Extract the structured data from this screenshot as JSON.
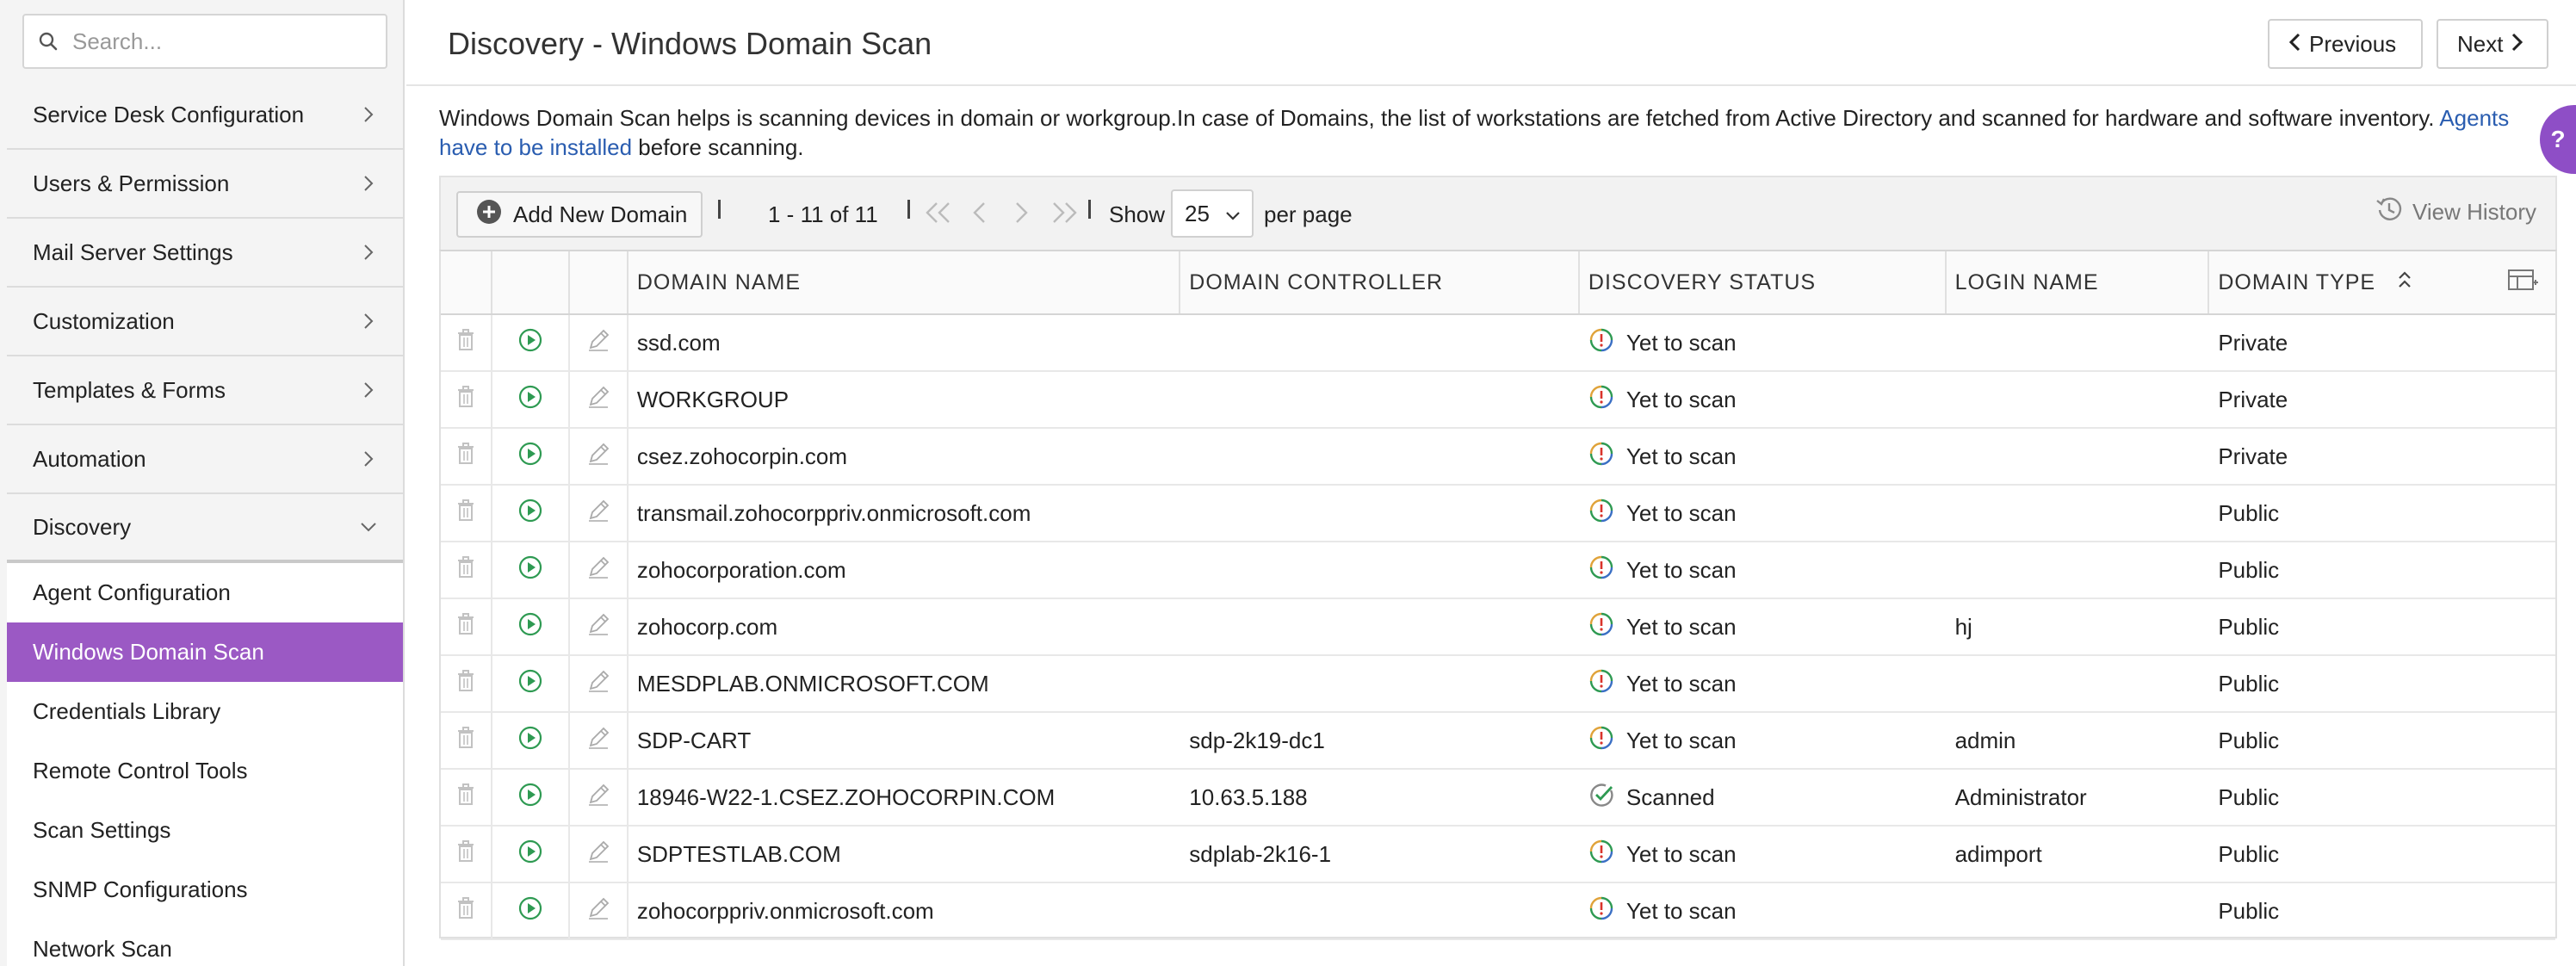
{
  "search": {
    "placeholder": "Search..."
  },
  "sidebar": {
    "items": [
      {
        "label": "Service Desk Configuration"
      },
      {
        "label": "Users & Permission"
      },
      {
        "label": "Mail Server Settings"
      },
      {
        "label": "Customization"
      },
      {
        "label": "Templates & Forms"
      },
      {
        "label": "Automation"
      },
      {
        "label": "Discovery"
      }
    ],
    "sub_items": [
      {
        "label": "Agent Configuration"
      },
      {
        "label": "Windows Domain Scan"
      },
      {
        "label": "Credentials Library"
      },
      {
        "label": "Remote Control Tools"
      },
      {
        "label": "Scan Settings"
      },
      {
        "label": "SNMP Configurations"
      },
      {
        "label": "Network Scan"
      }
    ],
    "active_sub": "Windows Domain Scan"
  },
  "header": {
    "title": "Discovery - Windows Domain Scan",
    "previous_label": "Previous",
    "next_label": "Next"
  },
  "description": {
    "text": "Windows Domain Scan helps is scanning devices in domain or workgroup.In case of Domains, the list of workstations are fetched from Active Directory and scanned for hardware and software inventory. ",
    "link_text": "Agents have to be installed",
    "suffix": " before scanning."
  },
  "help": {
    "label": "?"
  },
  "toolbar": {
    "add_label": "Add New Domain",
    "page_range": "1 - 11 of 11",
    "show_label": "Show",
    "per_page_value": "25",
    "per_page_label": "per page",
    "view_history_label": "View History"
  },
  "table": {
    "columns": [
      "DOMAIN NAME",
      "DOMAIN CONTROLLER",
      "DISCOVERY STATUS",
      "LOGIN NAME",
      "DOMAIN TYPE"
    ],
    "rows": [
      {
        "name": "ssd.com",
        "controller": "",
        "status": "Yet to scan",
        "login": "",
        "type": "Private"
      },
      {
        "name": "WORKGROUP",
        "controller": "",
        "status": "Yet to scan",
        "login": "",
        "type": "Private"
      },
      {
        "name": "csez.zohocorpin.com",
        "controller": "",
        "status": "Yet to scan",
        "login": "",
        "type": "Private"
      },
      {
        "name": "transmail.zohocorppriv.onmicrosoft.com",
        "controller": "",
        "status": "Yet to scan",
        "login": "",
        "type": "Public"
      },
      {
        "name": "zohocorporation.com",
        "controller": "",
        "status": "Yet to scan",
        "login": "",
        "type": "Public"
      },
      {
        "name": "zohocorp.com",
        "controller": "",
        "status": "Yet to scan",
        "login": "hj",
        "type": "Public"
      },
      {
        "name": "MESDPLAB.ONMICROSOFT.COM",
        "controller": "",
        "status": "Yet to scan",
        "login": "",
        "type": "Public"
      },
      {
        "name": "SDP-CART",
        "controller": "sdp-2k19-dc1",
        "status": "Yet to scan",
        "login": "admin",
        "type": "Public"
      },
      {
        "name": "18946-W22-1.CSEZ.ZOHOCORPIN.COM",
        "controller": "10.63.5.188",
        "status": "Scanned",
        "login": "Administrator",
        "type": "Public"
      },
      {
        "name": "SDPTESTLAB.COM",
        "controller": "sdplab-2k16-1",
        "status": "Yet to scan",
        "login": "adimport",
        "type": "Public"
      },
      {
        "name": "zohocorppriv.onmicrosoft.com",
        "controller": "",
        "status": "Yet to scan",
        "login": "",
        "type": "Public"
      }
    ]
  },
  "colors": {
    "accent": "#9b59c4",
    "link": "#2a5db0",
    "help_tab": "#8e4ec6",
    "run_icon": "#2e9a52"
  }
}
